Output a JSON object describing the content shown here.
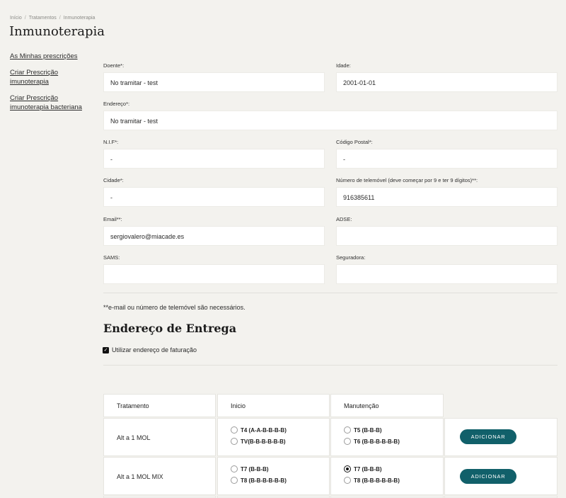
{
  "breadcrumb": [
    "Início",
    "Tratamentos",
    "Inmunoterapia"
  ],
  "breadcrumb_separator": "/",
  "page_title": "Inmunoterapia",
  "sidebar": {
    "items": [
      {
        "label": "As Minhas prescrições"
      },
      {
        "label": "Criar Prescrição imunoterapia"
      },
      {
        "label": "Criar Prescrição imunoterapia bacteriana"
      }
    ]
  },
  "form": {
    "doente": {
      "label": "Doente*:",
      "value": "No tramitar - test"
    },
    "idade": {
      "label": "Idade:",
      "value": "2001-01-01"
    },
    "endereco": {
      "label": "Endereço*:",
      "value": "No tramitar - test"
    },
    "nif": {
      "label": "N.I.F*:",
      "value": "-"
    },
    "codigo_postal": {
      "label": "Código Postal*:",
      "value": "-"
    },
    "cidade": {
      "label": "Cidade*:",
      "value": "-"
    },
    "telemovel": {
      "label": "Número de telemóvel (deve começar por 9 e ter 9 dígitos)**:",
      "value": "916385611"
    },
    "email": {
      "label": "Email**:",
      "value": "sergiovalero@miacade.es"
    },
    "adse": {
      "label": "ADSE:",
      "value": ""
    },
    "sams": {
      "label": "SAMS:",
      "value": ""
    },
    "seguradora": {
      "label": "Seguradora:",
      "value": ""
    }
  },
  "note": "**e-mail ou número de telemóvel são necessários.",
  "delivery": {
    "title": "Endereço de Entrega",
    "checkbox_label": "Utilizar endereço de faturação",
    "checked": true
  },
  "table": {
    "headers": [
      "Tratamento",
      "Inicio",
      "Manutenção"
    ],
    "rows": [
      {
        "name": "Alt a 1 MOL",
        "inicio": [
          {
            "label": "T4 (A-A-B-B-B-B)",
            "checked": false
          },
          {
            "label": "TV(B-B-B-B-B-B)",
            "checked": false
          }
        ],
        "manutencao": [
          {
            "label": "T5 (B-B-B)",
            "checked": false
          },
          {
            "label": "T6 (B-B-B-B-B-B)",
            "checked": false
          }
        ],
        "button": "ADICIONAR"
      },
      {
        "name": "Alt a 1 MOL MIX",
        "inicio": [
          {
            "label": "T7 (B-B-B)",
            "checked": false
          },
          {
            "label": "T8 (B-B-B-B-B-B)",
            "checked": false
          }
        ],
        "manutencao": [
          {
            "label": "T7 (B-B-B)",
            "checked": true
          },
          {
            "label": "T8 (B-B-B-B-B-B)",
            "checked": false
          }
        ],
        "button": "ADICIONAR"
      }
    ]
  },
  "colors": {
    "background": "#f3f2ee",
    "button": "#11606a",
    "input": "#ffffff"
  }
}
